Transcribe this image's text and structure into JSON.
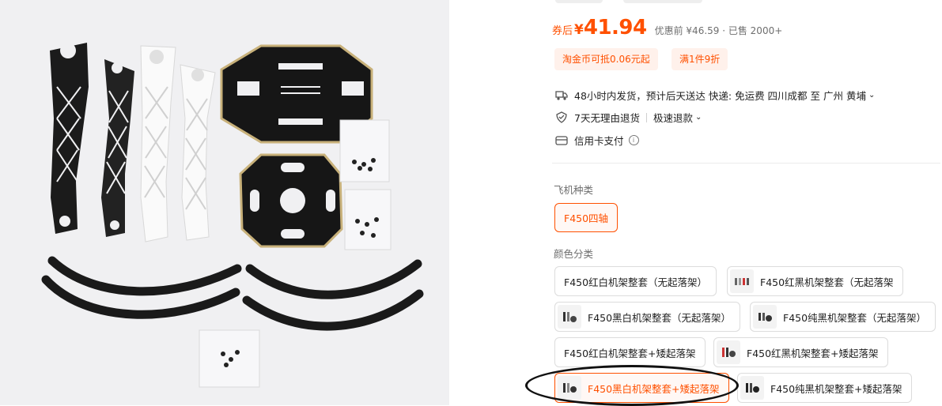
{
  "price": {
    "coupon_label": "券后",
    "currency": "¥",
    "amount": "41.94",
    "original": "优惠前 ¥46.59 · 已售 2000+"
  },
  "promos": [
    "淘金币可抵0.06元起",
    "满1件9折"
  ],
  "shipping": {
    "text": "48小时内发货，预计后天送达  快递: 免运费  四川成都 至 广州 黄埔",
    "icon": "truck-icon"
  },
  "returns": {
    "text": "7天无理由退货",
    "fast_refund": "极速退款",
    "icon": "shield-icon"
  },
  "payment": {
    "text": "信用卡支付",
    "icon": "credit-card-icon"
  },
  "aircraft_type": {
    "label": "飞机种类",
    "options": [
      "F450四轴"
    ]
  },
  "color_category": {
    "label": "颜色分类",
    "options": [
      "F450红白机架整套（无起落架）",
      "F450红黑机架整套（无起落架",
      "F450黑白机架整套（无起落架）",
      "F450纯黑机架整套（无起落架）",
      "F450红白机架整套+矮起落架",
      "F450红黑机架整套+矮起落架",
      "F450黑白机架整套+矮起落架",
      "F450纯黑机架整套+矮起落架"
    ],
    "selected": "F450黑白机架整套+矮起落架"
  },
  "colors": {
    "accent": "#ff5000",
    "accent_bg": "#fff1eb",
    "border": "#dcdcdc"
  }
}
